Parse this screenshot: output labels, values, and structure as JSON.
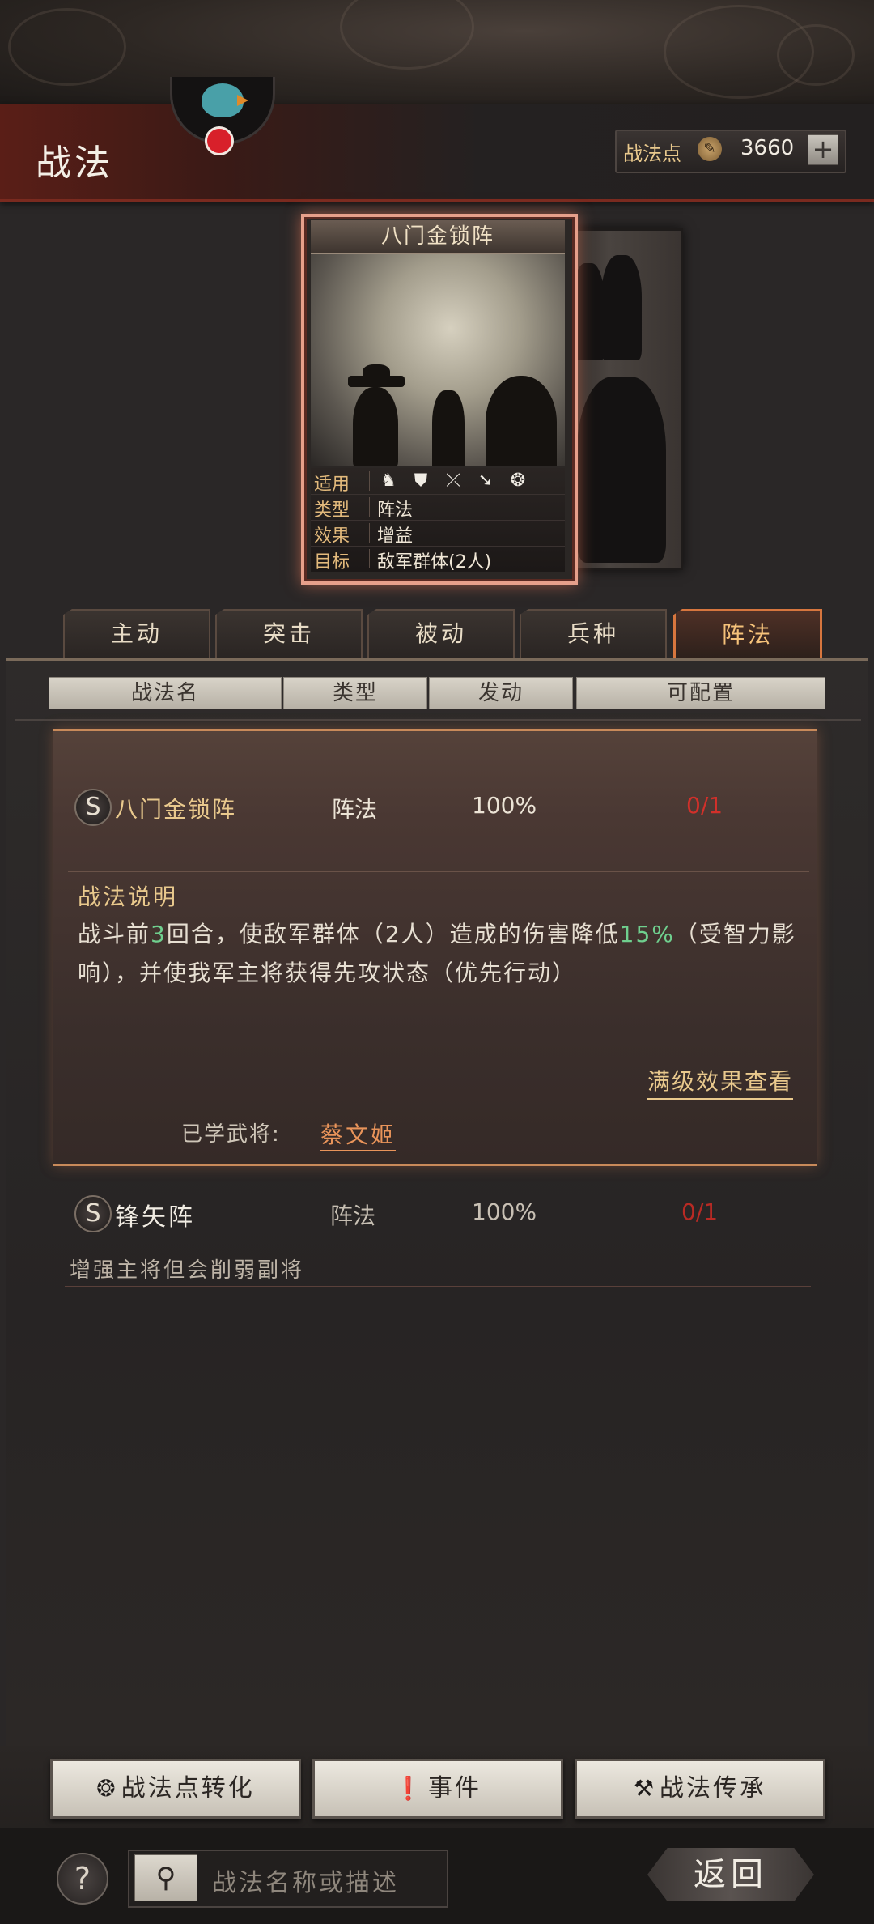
{
  "header": {
    "title": "战法",
    "points_label": "战法点",
    "points_value": "3660",
    "add_label": "+"
  },
  "card": {
    "title": "八门金锁阵",
    "info": [
      {
        "key": "适用",
        "value": ""
      },
      {
        "key": "类型",
        "value": "阵法"
      },
      {
        "key": "效果",
        "value": "增益"
      },
      {
        "key": "目标",
        "value": "敌军群体(2人)"
      }
    ],
    "troop_icons": [
      "cavalry-icon",
      "shield-icon",
      "archer-icon",
      "spear-icon",
      "siege-icon"
    ]
  },
  "tabs": [
    "主动",
    "突击",
    "被动",
    "兵种",
    "阵法"
  ],
  "active_tab": "阵法",
  "columns": [
    "战法名",
    "类型",
    "发动",
    "可配置"
  ],
  "tactics": [
    {
      "grade": "S",
      "name": "八门金锁阵",
      "type": "阵法",
      "rate": "100%",
      "config": "0/1",
      "description_title": "战法说明",
      "description_part1": "战斗前",
      "description_rounds": "3",
      "description_part2": "回合，使敌军群体（2人）造成的伤害降低",
      "description_percent": "15%",
      "description_part3": "（受智力影响），并使我军主将获得先攻状态（优先行动）",
      "max_link": "满级效果查看",
      "learned_label": "已学武将:",
      "learned_general": "蔡文姬"
    },
    {
      "grade": "S",
      "name": "锋矢阵",
      "type": "阵法",
      "rate": "100%",
      "config": "0/1",
      "summary": "增强主将但会削弱副将"
    }
  ],
  "buttons": {
    "convert": "战法点转化",
    "event": "事件",
    "inherit": "战法传承"
  },
  "search": {
    "placeholder": "战法名称或描述"
  },
  "help_label": "?",
  "back_label": "返回",
  "colors": {
    "accent": "#e9c98d",
    "config_red": "#d2302a",
    "highlight_green": "#6fcf8e",
    "active_tab_border": "#d7763e"
  }
}
